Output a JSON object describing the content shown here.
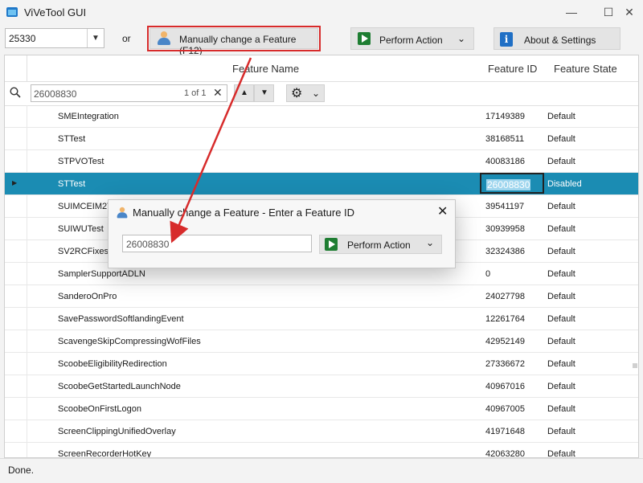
{
  "window": {
    "title": "ViVeTool GUI",
    "controls": {
      "minimize": "—",
      "maximize": "☐",
      "close": "✕"
    }
  },
  "toolbar": {
    "build_value": "25330",
    "or_label": "or",
    "manual_button_label": "Manually change a Feature (F12)",
    "perform_action_label": "Perform Action",
    "about_label": "About & Settings"
  },
  "grid": {
    "columns": {
      "name": "Feature Name",
      "id": "Feature ID",
      "state": "Feature State"
    },
    "search": {
      "value": "26008830",
      "match_count": "1 of 1"
    },
    "rows": [
      {
        "name": "SMEIntegration",
        "id": "17149389",
        "state": "Default"
      },
      {
        "name": "STTest",
        "id": "38168511",
        "state": "Default"
      },
      {
        "name": "STPVOTest",
        "id": "40083186",
        "state": "Default"
      },
      {
        "name": "STTest",
        "id": "26008830",
        "state": "Disabled",
        "selected": true
      },
      {
        "name": "SUIMCEIM2T",
        "id": "39541197",
        "state": "Default"
      },
      {
        "name": "SUIWUTest",
        "id": "30939958",
        "state": "Default"
      },
      {
        "name": "SV2RCFixesT",
        "id": "32324386",
        "state": "Default"
      },
      {
        "name": "SamplerSupportADLN",
        "id": "0",
        "state": "Default"
      },
      {
        "name": "SanderoOnPro",
        "id": "24027798",
        "state": "Default"
      },
      {
        "name": "SavePasswordSoftlandingEvent",
        "id": "12261764",
        "state": "Default"
      },
      {
        "name": "ScavengeSkipCompressingWofFiles",
        "id": "42952149",
        "state": "Default"
      },
      {
        "name": "ScoobeEligibilityRedirection",
        "id": "27336672",
        "state": "Default"
      },
      {
        "name": "ScoobeGetStartedLaunchNode",
        "id": "40967016",
        "state": "Default"
      },
      {
        "name": "ScoobeOnFirstLogon",
        "id": "40967005",
        "state": "Default"
      },
      {
        "name": "ScreenClippingUnifiedOverlay",
        "id": "41971648",
        "state": "Default"
      },
      {
        "name": "ScreenRecorderHotKey",
        "id": "42063280",
        "state": "Default"
      }
    ]
  },
  "dialog": {
    "title": "Manually change a Feature - Enter a Feature ID",
    "input_value": "26008830",
    "perform_action_label": "Perform Action"
  },
  "status": {
    "text": "Done."
  },
  "icons": {
    "app": "vivetool-app-icon",
    "manual": "person-icon",
    "perform": "play-icon",
    "about": "info-icon",
    "search": "search-icon",
    "settings": "gear-icon"
  },
  "colors": {
    "selected_row": "#1b8cb3",
    "annotation": "#d72b2b"
  }
}
